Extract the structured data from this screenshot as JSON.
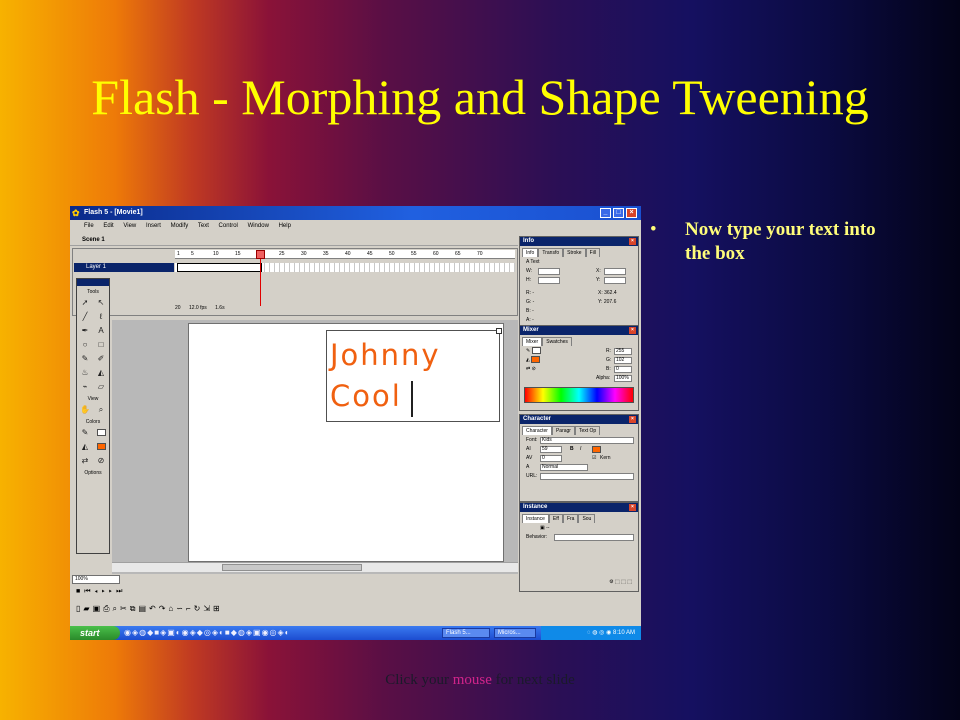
{
  "slide": {
    "title": "Flash - Morphing and Shape Tweening",
    "bullet": "Now type your text into the box",
    "footer_pre": "Click your ",
    "footer_mid": "mouse",
    "footer_post": " for next slide"
  },
  "app": {
    "window_title": "Flash 5 - [Movie1]",
    "menu": [
      "File",
      "Edit",
      "View",
      "Insert",
      "Modify",
      "Text",
      "Control",
      "Window",
      "Help"
    ],
    "scene": "Scene 1",
    "layer": "Layer 1",
    "ruler": [
      "1",
      "5",
      "10",
      "15",
      "20",
      "25",
      "30",
      "35",
      "40",
      "45",
      "50",
      "55",
      "60",
      "65",
      "70"
    ],
    "frame": "20",
    "fps": "12.0 fps",
    "time": "1.6s",
    "tools_label": "Tools",
    "view_label": "View",
    "colors_label": "Colors",
    "options_label": "Options",
    "stage_text_line1": "Johnny",
    "stage_text_line2": "Cool",
    "zoom": "100%"
  },
  "panels": {
    "info": {
      "title": "Info",
      "tabs": [
        "Info",
        "Transfo",
        "Stroke",
        "Fill"
      ],
      "text_label": "Text",
      "w": "W:",
      "h": "H:",
      "x": "X:",
      "y": "Y:",
      "r": "R: -",
      "g": "G: -",
      "b": "B: -",
      "a": "A: -",
      "cx": "X: 362.4",
      "cy": "Y: 207.6"
    },
    "mixer": {
      "title": "Mixer",
      "tabs": [
        "Mixer",
        "Swatches"
      ],
      "r_label": "R:",
      "r": "255",
      "g_label": "G:",
      "g": "102",
      "b_label": "B:",
      "b": "0",
      "alpha_label": "Alpha:",
      "alpha": "100%"
    },
    "character": {
      "title": "Character",
      "tabs": [
        "Character",
        "Paragr",
        "Text Op"
      ],
      "font_label": "Font:",
      "font": "Kids",
      "size": "59",
      "tracking": "0",
      "kern": "Kern",
      "baseline": "Normal",
      "url_label": "URL:"
    },
    "instance": {
      "title": "Instance",
      "tabs": [
        "Instance",
        "Eff",
        "Fra",
        "Sou"
      ],
      "dash": "--",
      "behavior_label": "Behavior:"
    }
  },
  "taskbar": {
    "start": "start",
    "tasks": [
      "Flash 5...",
      "Micros..."
    ],
    "clock": "8:10 AM"
  },
  "colors": {
    "title": "#ffff00",
    "text_orange": "#f06010",
    "mixer_fill": "#ff6600"
  }
}
